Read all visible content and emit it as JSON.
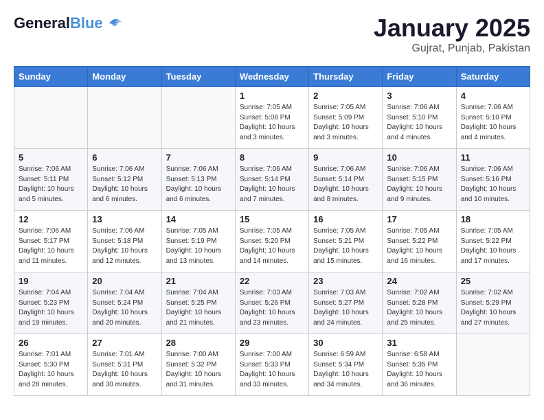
{
  "logo": {
    "line1": "General",
    "line2": "Blue"
  },
  "title": "January 2025",
  "subtitle": "Gujrat, Punjab, Pakistan",
  "days_header": [
    "Sunday",
    "Monday",
    "Tuesday",
    "Wednesday",
    "Thursday",
    "Friday",
    "Saturday"
  ],
  "weeks": [
    [
      {
        "day": "",
        "sunrise": "",
        "sunset": "",
        "daylight": ""
      },
      {
        "day": "",
        "sunrise": "",
        "sunset": "",
        "daylight": ""
      },
      {
        "day": "",
        "sunrise": "",
        "sunset": "",
        "daylight": ""
      },
      {
        "day": "1",
        "sunrise": "Sunrise: 7:05 AM",
        "sunset": "Sunset: 5:08 PM",
        "daylight": "Daylight: 10 hours and 3 minutes."
      },
      {
        "day": "2",
        "sunrise": "Sunrise: 7:05 AM",
        "sunset": "Sunset: 5:09 PM",
        "daylight": "Daylight: 10 hours and 3 minutes."
      },
      {
        "day": "3",
        "sunrise": "Sunrise: 7:06 AM",
        "sunset": "Sunset: 5:10 PM",
        "daylight": "Daylight: 10 hours and 4 minutes."
      },
      {
        "day": "4",
        "sunrise": "Sunrise: 7:06 AM",
        "sunset": "Sunset: 5:10 PM",
        "daylight": "Daylight: 10 hours and 4 minutes."
      }
    ],
    [
      {
        "day": "5",
        "sunrise": "Sunrise: 7:06 AM",
        "sunset": "Sunset: 5:11 PM",
        "daylight": "Daylight: 10 hours and 5 minutes."
      },
      {
        "day": "6",
        "sunrise": "Sunrise: 7:06 AM",
        "sunset": "Sunset: 5:12 PM",
        "daylight": "Daylight: 10 hours and 6 minutes."
      },
      {
        "day": "7",
        "sunrise": "Sunrise: 7:06 AM",
        "sunset": "Sunset: 5:13 PM",
        "daylight": "Daylight: 10 hours and 6 minutes."
      },
      {
        "day": "8",
        "sunrise": "Sunrise: 7:06 AM",
        "sunset": "Sunset: 5:14 PM",
        "daylight": "Daylight: 10 hours and 7 minutes."
      },
      {
        "day": "9",
        "sunrise": "Sunrise: 7:06 AM",
        "sunset": "Sunset: 5:14 PM",
        "daylight": "Daylight: 10 hours and 8 minutes."
      },
      {
        "day": "10",
        "sunrise": "Sunrise: 7:06 AM",
        "sunset": "Sunset: 5:15 PM",
        "daylight": "Daylight: 10 hours and 9 minutes."
      },
      {
        "day": "11",
        "sunrise": "Sunrise: 7:06 AM",
        "sunset": "Sunset: 5:16 PM",
        "daylight": "Daylight: 10 hours and 10 minutes."
      }
    ],
    [
      {
        "day": "12",
        "sunrise": "Sunrise: 7:06 AM",
        "sunset": "Sunset: 5:17 PM",
        "daylight": "Daylight: 10 hours and 11 minutes."
      },
      {
        "day": "13",
        "sunrise": "Sunrise: 7:06 AM",
        "sunset": "Sunset: 5:18 PM",
        "daylight": "Daylight: 10 hours and 12 minutes."
      },
      {
        "day": "14",
        "sunrise": "Sunrise: 7:05 AM",
        "sunset": "Sunset: 5:19 PM",
        "daylight": "Daylight: 10 hours and 13 minutes."
      },
      {
        "day": "15",
        "sunrise": "Sunrise: 7:05 AM",
        "sunset": "Sunset: 5:20 PM",
        "daylight": "Daylight: 10 hours and 14 minutes."
      },
      {
        "day": "16",
        "sunrise": "Sunrise: 7:05 AM",
        "sunset": "Sunset: 5:21 PM",
        "daylight": "Daylight: 10 hours and 15 minutes."
      },
      {
        "day": "17",
        "sunrise": "Sunrise: 7:05 AM",
        "sunset": "Sunset: 5:22 PM",
        "daylight": "Daylight: 10 hours and 16 minutes."
      },
      {
        "day": "18",
        "sunrise": "Sunrise: 7:05 AM",
        "sunset": "Sunset: 5:22 PM",
        "daylight": "Daylight: 10 hours and 17 minutes."
      }
    ],
    [
      {
        "day": "19",
        "sunrise": "Sunrise: 7:04 AM",
        "sunset": "Sunset: 5:23 PM",
        "daylight": "Daylight: 10 hours and 19 minutes."
      },
      {
        "day": "20",
        "sunrise": "Sunrise: 7:04 AM",
        "sunset": "Sunset: 5:24 PM",
        "daylight": "Daylight: 10 hours and 20 minutes."
      },
      {
        "day": "21",
        "sunrise": "Sunrise: 7:04 AM",
        "sunset": "Sunset: 5:25 PM",
        "daylight": "Daylight: 10 hours and 21 minutes."
      },
      {
        "day": "22",
        "sunrise": "Sunrise: 7:03 AM",
        "sunset": "Sunset: 5:26 PM",
        "daylight": "Daylight: 10 hours and 23 minutes."
      },
      {
        "day": "23",
        "sunrise": "Sunrise: 7:03 AM",
        "sunset": "Sunset: 5:27 PM",
        "daylight": "Daylight: 10 hours and 24 minutes."
      },
      {
        "day": "24",
        "sunrise": "Sunrise: 7:02 AM",
        "sunset": "Sunset: 5:28 PM",
        "daylight": "Daylight: 10 hours and 25 minutes."
      },
      {
        "day": "25",
        "sunrise": "Sunrise: 7:02 AM",
        "sunset": "Sunset: 5:29 PM",
        "daylight": "Daylight: 10 hours and 27 minutes."
      }
    ],
    [
      {
        "day": "26",
        "sunrise": "Sunrise: 7:01 AM",
        "sunset": "Sunset: 5:30 PM",
        "daylight": "Daylight: 10 hours and 28 minutes."
      },
      {
        "day": "27",
        "sunrise": "Sunrise: 7:01 AM",
        "sunset": "Sunset: 5:31 PM",
        "daylight": "Daylight: 10 hours and 30 minutes."
      },
      {
        "day": "28",
        "sunrise": "Sunrise: 7:00 AM",
        "sunset": "Sunset: 5:32 PM",
        "daylight": "Daylight: 10 hours and 31 minutes."
      },
      {
        "day": "29",
        "sunrise": "Sunrise: 7:00 AM",
        "sunset": "Sunset: 5:33 PM",
        "daylight": "Daylight: 10 hours and 33 minutes."
      },
      {
        "day": "30",
        "sunrise": "Sunrise: 6:59 AM",
        "sunset": "Sunset: 5:34 PM",
        "daylight": "Daylight: 10 hours and 34 minutes."
      },
      {
        "day": "31",
        "sunrise": "Sunrise: 6:58 AM",
        "sunset": "Sunset: 5:35 PM",
        "daylight": "Daylight: 10 hours and 36 minutes."
      },
      {
        "day": "",
        "sunrise": "",
        "sunset": "",
        "daylight": ""
      }
    ]
  ]
}
